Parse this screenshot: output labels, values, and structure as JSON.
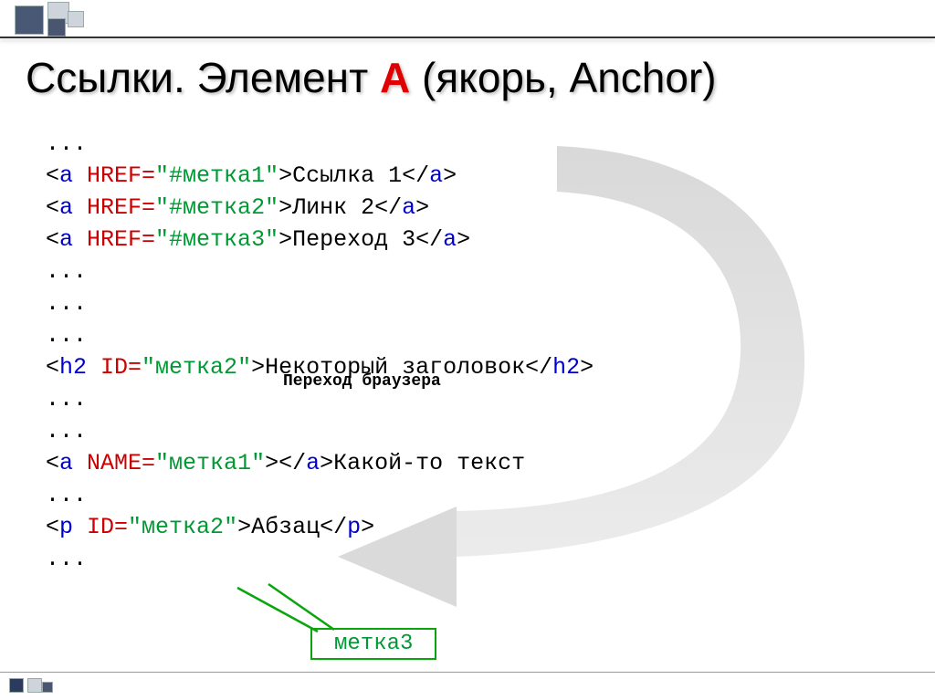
{
  "title": {
    "parts": [
      "Ссылки. Элемент ",
      "A",
      " (якорь, Anchor)"
    ]
  },
  "code": {
    "ellipsis": "...",
    "lt": "<",
    "gt": ">",
    "tag_a": "a",
    "tag_h2": "h2",
    "tag_p": "p",
    "close_a": "</",
    "href_kw": " HREF=",
    "id_kw": " ID=",
    "name_kw": " NAME=",
    "link1": {
      "href": "\"#метка1\"",
      "text": "Ссылка 1"
    },
    "link2": {
      "href": "\"#метка2\"",
      "text": "Линк 2"
    },
    "link3": {
      "href": "\"#метка3\"",
      "text": "Переход 3"
    },
    "h2": {
      "id": "\"метка2\"",
      "text": "Некоторый заголовок"
    },
    "named": {
      "name": "\"метка1\"",
      "text": "Какой-то текст"
    },
    "para": {
      "id": "\"метка2\"",
      "text": "Абзац"
    }
  },
  "browser_label": "Переход браузера",
  "box_label": "метка3"
}
